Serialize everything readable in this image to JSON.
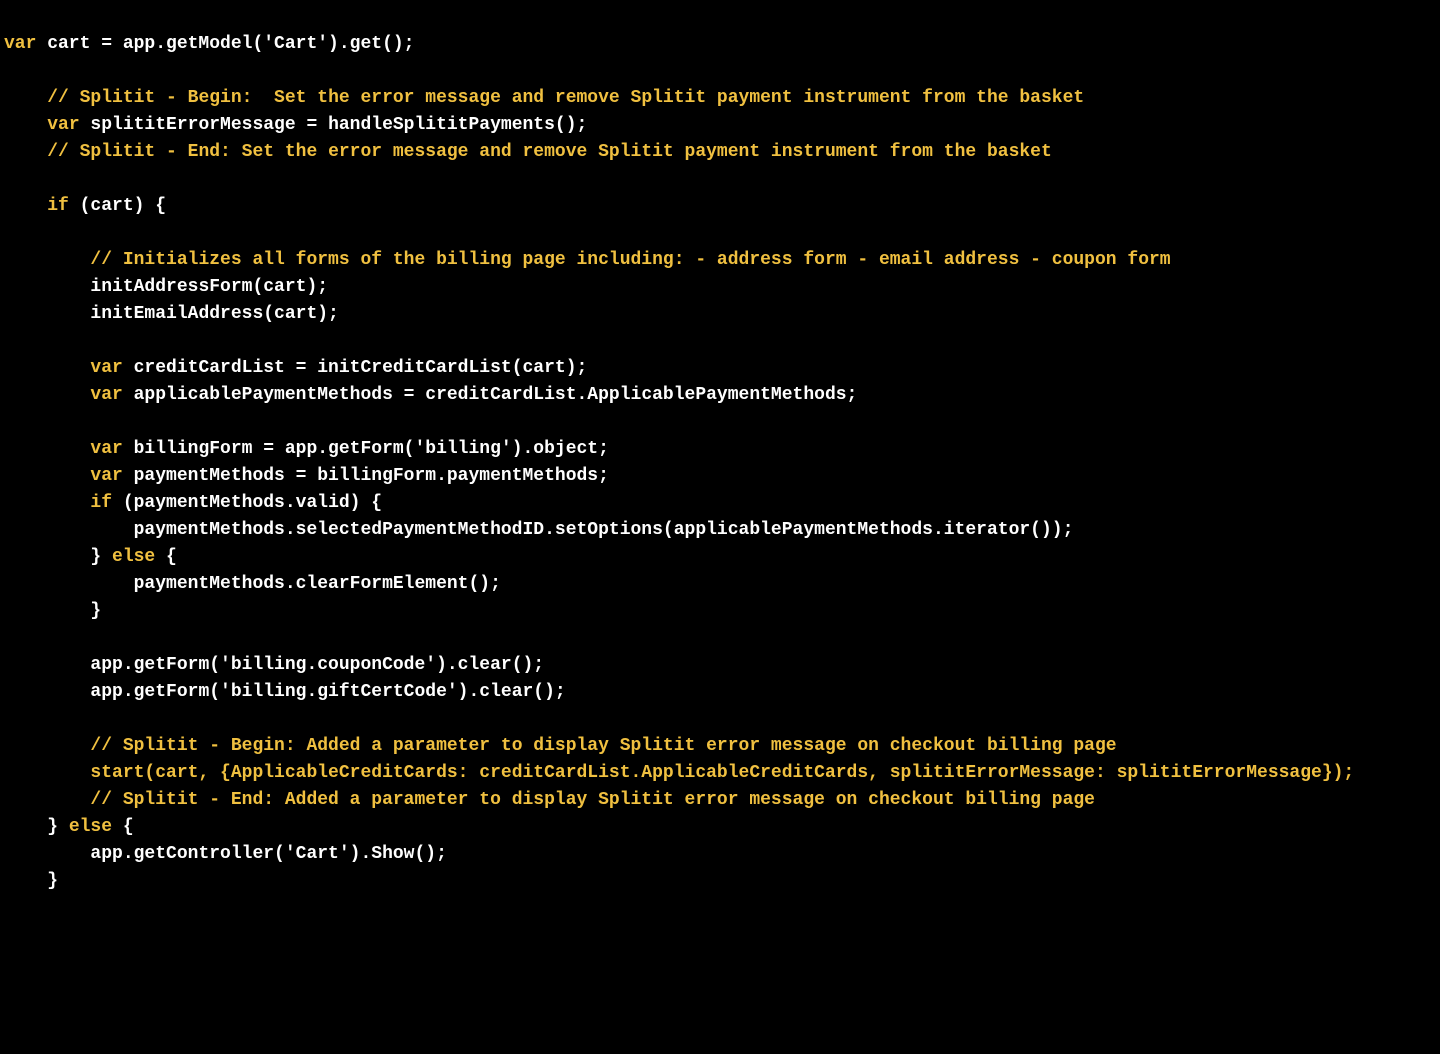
{
  "code": {
    "l01_kw_var": "var",
    "l01_rest": " cart = app.getModel('Cart').get();",
    "l02": "",
    "l03_indent": "    ",
    "l03_comment": "// Splitit - Begin:  Set the error message and remove Splitit payment instrument from the basket",
    "l04_indent": "    ",
    "l04_kw_var": "var",
    "l04_rest": " splititErrorMessage = handleSplititPayments();",
    "l05_indent": "    ",
    "l05_comment": "// Splitit - End: Set the error message and remove Splitit payment instrument from the basket",
    "l06": "",
    "l07_indent": "    ",
    "l07_kw_if": "if",
    "l07_rest": " (cart) {",
    "l08": "",
    "l09_indent": "        ",
    "l09_comment": "// Initializes all forms of the billing page including: - address form - email address - coupon form",
    "l10_indent": "        ",
    "l10_rest": "initAddressForm(cart);",
    "l11_indent": "        ",
    "l11_rest": "initEmailAddress(cart);",
    "l12": "",
    "l13_indent": "        ",
    "l13_kw_var": "var",
    "l13_rest": " creditCardList = initCreditCardList(cart);",
    "l14_indent": "        ",
    "l14_kw_var": "var",
    "l14_rest": " applicablePaymentMethods = creditCardList.ApplicablePaymentMethods;",
    "l15": "",
    "l16_indent": "        ",
    "l16_kw_var": "var",
    "l16_rest": " billingForm = app.getForm('billing').object;",
    "l17_indent": "        ",
    "l17_kw_var": "var",
    "l17_rest": " paymentMethods = billingForm.paymentMethods;",
    "l18_indent": "        ",
    "l18_kw_if": "if",
    "l18_rest": " (paymentMethods.valid) {",
    "l19_indent": "            ",
    "l19_rest": "paymentMethods.selectedPaymentMethodID.setOptions(applicablePaymentMethods.iterator());",
    "l20_indent": "        ",
    "l20_rest_a": "} ",
    "l20_kw_else": "else",
    "l20_rest_b": " {",
    "l21_indent": "            ",
    "l21_rest": "paymentMethods.clearFormElement();",
    "l22_indent": "        ",
    "l22_rest": "}",
    "l23": "",
    "l24_indent": "        ",
    "l24_rest": "app.getForm('billing.couponCode').clear();",
    "l25_indent": "        ",
    "l25_rest": "app.getForm('billing.giftCertCode').clear();",
    "l26": "",
    "l27_indent": "        ",
    "l27_comment": "// Splitit - Begin: Added a parameter to display Splitit error message on checkout billing page",
    "l28_indent": "        ",
    "l28_rest": "start(cart, {ApplicableCreditCards: creditCardList.ApplicableCreditCards, splititErrorMessage: splititErrorMessage});",
    "l29_indent": "        ",
    "l29_comment": "// Splitit - End: Added a parameter to display Splitit error message on checkout billing page",
    "l30_indent": "    ",
    "l30_rest_a": "} ",
    "l30_kw_else": "else",
    "l30_rest_b": " {",
    "l31_indent": "        ",
    "l31_rest": "app.getController('Cart').Show();",
    "l32_indent": "    ",
    "l32_rest": "}"
  }
}
